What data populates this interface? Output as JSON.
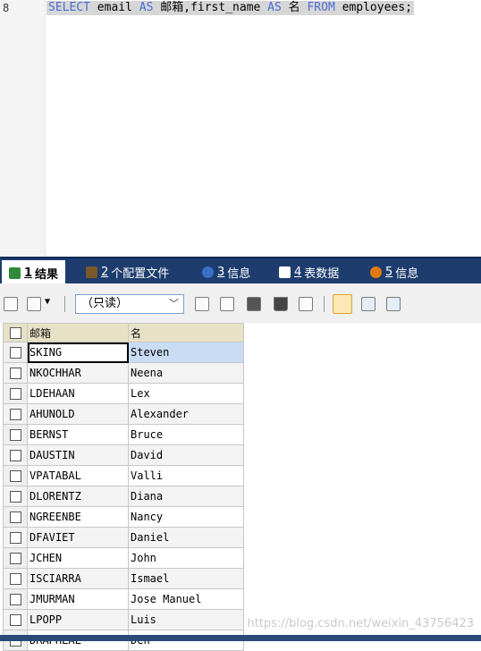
{
  "editor": {
    "line_number": "8",
    "tokens": [
      {
        "text": "SELECT",
        "kw": true
      },
      {
        "text": " email ",
        "kw": false
      },
      {
        "text": "AS",
        "kw": true
      },
      {
        "text": " 邮箱,first_name ",
        "kw": false
      },
      {
        "text": "AS",
        "kw": true
      },
      {
        "text": " 名 ",
        "kw": false
      },
      {
        "text": "FROM",
        "kw": true
      },
      {
        "text": " employees;",
        "kw": false
      }
    ]
  },
  "tabs": [
    {
      "num": "1",
      "label": "结果",
      "active": true,
      "icon": "result-grid-icon"
    },
    {
      "num": "2",
      "label": "个配置文件",
      "active": false,
      "icon": "profile-icon"
    },
    {
      "num": "3",
      "label": "信息",
      "active": false,
      "icon": "info-icon"
    },
    {
      "num": "4",
      "label": "表数据",
      "active": false,
      "icon": "table-data-icon"
    },
    {
      "num": "5",
      "label": "信息",
      "active": false,
      "icon": "info-icon-2"
    }
  ],
  "toolbar": {
    "mode_select_value": "（只读）"
  },
  "grid": {
    "columns": [
      "邮箱",
      "名"
    ],
    "rows": [
      [
        "SKING",
        "Steven"
      ],
      [
        "NKOCHHAR",
        "Neena"
      ],
      [
        "LDEHAAN",
        "Lex"
      ],
      [
        "AHUNOLD",
        "Alexander"
      ],
      [
        "BERNST",
        "Bruce"
      ],
      [
        "DAUSTIN",
        "David"
      ],
      [
        "VPATABAL",
        "Valli"
      ],
      [
        "DLORENTZ",
        "Diana"
      ],
      [
        "NGREENBE",
        "Nancy"
      ],
      [
        "DFAVIET",
        "Daniel"
      ],
      [
        "JCHEN",
        "John"
      ],
      [
        "ISCIARRA",
        "Ismael"
      ],
      [
        "JMURMAN",
        "Jose Manuel"
      ],
      [
        "LPOPP",
        "Luis"
      ],
      [
        "DRAPHEAL",
        "Den"
      ]
    ]
  },
  "watermark": "https://blog.csdn.net/weixin_43756423"
}
